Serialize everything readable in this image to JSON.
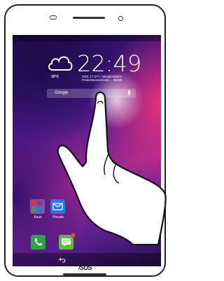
{
  "device": {
    "brand_logo": "/SUS"
  },
  "statusbar": {
    "left_text": "...",
    "right_text": "..."
  },
  "weather": {
    "icon": "cloud-icon",
    "temperature": "16°C",
    "time": "22:49",
    "date": "SOB, 17 STY, Taimaul District",
    "location": "Predominantemente ... 8MWE"
  },
  "search": {
    "label": "Google",
    "mic_icon": "mic-icon"
  },
  "apps": [
    {
      "label": "Asus",
      "icon": "folder-icon"
    },
    {
      "label": "Poczta",
      "icon": "mail-icon"
    }
  ],
  "dock": {
    "phone_icon": "phone-icon",
    "messages_icon": "messages-icon",
    "messages_badge": "3"
  },
  "navbar": {
    "back_icon": "back-icon"
  },
  "colors": {
    "wallpaper_dark": "#210f58",
    "wallpaper_pink": "#e7307a",
    "mail": "#2f76d8",
    "phone": "#2fa24a",
    "messages": "#5cbb3c"
  }
}
